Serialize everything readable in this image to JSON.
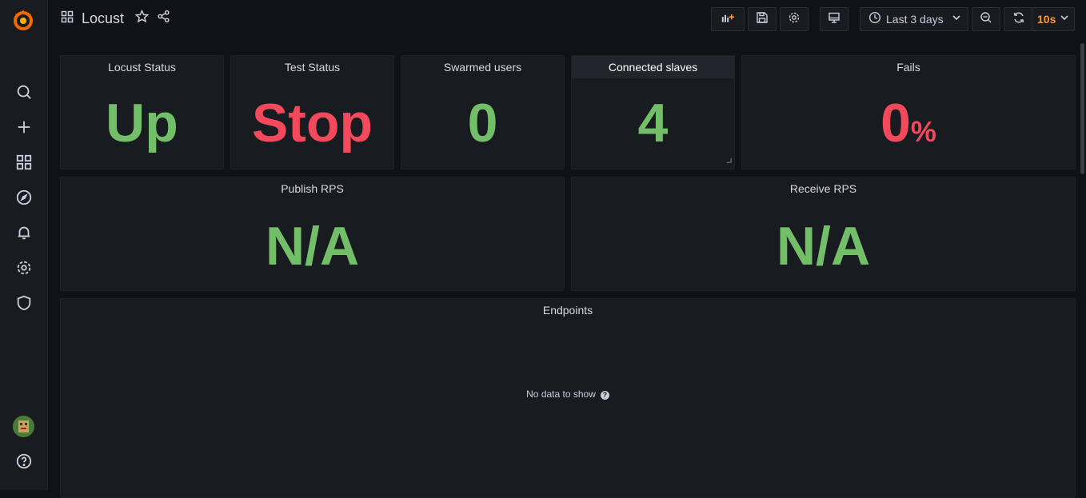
{
  "dashboard": {
    "title": "Locust"
  },
  "toolbar": {
    "time_range": "Last 3 days",
    "refresh_interval": "10s"
  },
  "panels": {
    "locust_status": {
      "title": "Locust Status",
      "value": "Up"
    },
    "test_status": {
      "title": "Test Status",
      "value": "Stop"
    },
    "swarmed_users": {
      "title": "Swarmed users",
      "value": "0"
    },
    "connected_slaves": {
      "title": "Connected slaves",
      "value": "4"
    },
    "fails": {
      "title": "Fails",
      "value": "0",
      "unit": "%"
    },
    "publish_rps": {
      "title": "Publish RPS",
      "value": "N/A"
    },
    "receive_rps": {
      "title": "Receive RPS",
      "value": "N/A"
    },
    "endpoints": {
      "title": "Endpoints",
      "message": "No data to show"
    }
  },
  "colors": {
    "ok_green": "#73bf69",
    "error_red": "#f2495c",
    "accent_orange": "#ff9830",
    "background": "#111217",
    "panel": "#181b1f"
  }
}
